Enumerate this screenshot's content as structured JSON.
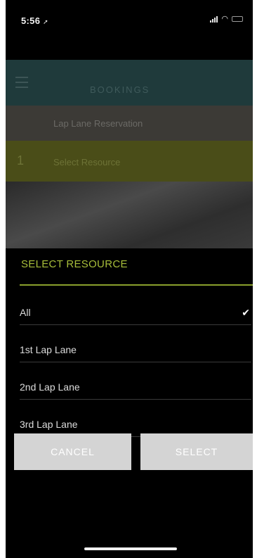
{
  "status_bar": {
    "time": "5:56",
    "location_icon": "location-arrow-icon",
    "icons": [
      "signal-icon",
      "wifi-icon",
      "battery-icon"
    ]
  },
  "app": {
    "header_title": "BOOKINGS",
    "menu_icon": "hamburger-menu-icon",
    "reservation_label": "Lap Lane Reservation",
    "step_number": "1",
    "resource_label": "Select Resource"
  },
  "picker": {
    "title": "SELECT RESOURCE",
    "options": [
      {
        "label": "All",
        "selected": true
      },
      {
        "label": "1st Lap Lane",
        "selected": false
      },
      {
        "label": "2nd Lap Lane",
        "selected": false
      },
      {
        "label": "3rd Lap Lane",
        "selected": false
      }
    ],
    "check_mark": "✔",
    "cancel_label": "CANCEL",
    "select_label": "SELECT"
  },
  "colors": {
    "accent_green": "#a7bd3a",
    "button_gray": "#d4d4d4",
    "background": "#000000"
  }
}
